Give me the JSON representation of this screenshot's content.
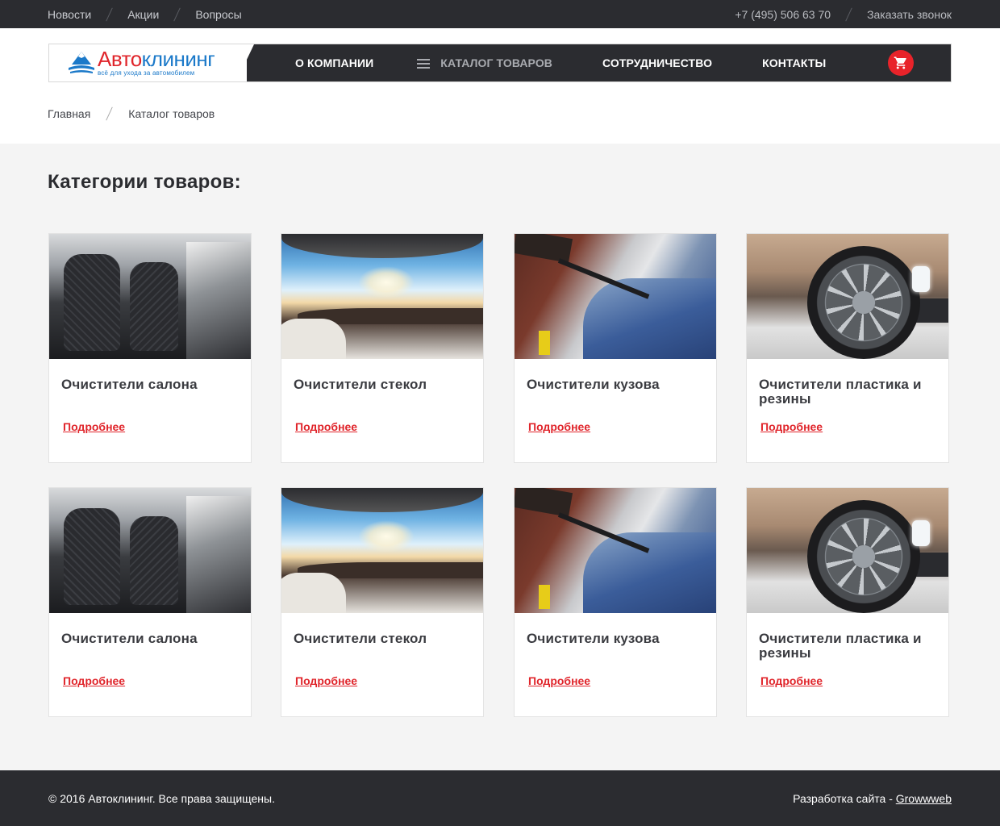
{
  "topbar": {
    "links": [
      "Новости",
      "Акции",
      "Вопросы"
    ],
    "phone": "+7 (495) 506 63 70",
    "callback": "Заказать звонок"
  },
  "logo": {
    "part1": "Авто",
    "part2": "клининг",
    "tagline": "всё для ухода за автомобилем"
  },
  "nav": {
    "items": [
      "О КОМПАНИИ",
      "КАТАЛОГ ТОВАРОВ",
      "СОТРУДНИЧЕСТВО",
      "КОНТАКТЫ"
    ],
    "active": "КАТАЛОГ ТОВАРОВ",
    "cart_icon": "cart-icon"
  },
  "breadcrumb": [
    "Главная",
    "Каталог товаров"
  ],
  "page": {
    "title": "Категории товаров:"
  },
  "categories": [
    {
      "title": "Очистители салона",
      "more": "Подробнее",
      "image": "car-interior-seats"
    },
    {
      "title": "Очистители стекол",
      "more": "Подробнее",
      "image": "car-windshield-interior"
    },
    {
      "title": "Очистители кузова",
      "more": "Подробнее",
      "image": "car-pressure-wash"
    },
    {
      "title": "Очистители пластика и резины",
      "more": "Подробнее",
      "image": "car-wheel-tire"
    },
    {
      "title": "Очистители салона",
      "more": "Подробнее",
      "image": "car-interior-seats"
    },
    {
      "title": "Очистители стекол",
      "more": "Подробнее",
      "image": "car-windshield-interior"
    },
    {
      "title": "Очистители кузова",
      "more": "Подробнее",
      "image": "car-pressure-wash"
    },
    {
      "title": "Очистители пластика и резины",
      "more": "Подробнее",
      "image": "car-wheel-tire"
    }
  ],
  "footer": {
    "copyright": "© 2016 Автоклининг. Все права защищены.",
    "dev_label": "Разработка сайта - ",
    "dev_link": "Growwweb"
  },
  "colors": {
    "dark": "#2b2c30",
    "accent_red": "#e0252b",
    "logo_blue": "#1b79c9",
    "page_bg": "#f4f4f4"
  }
}
